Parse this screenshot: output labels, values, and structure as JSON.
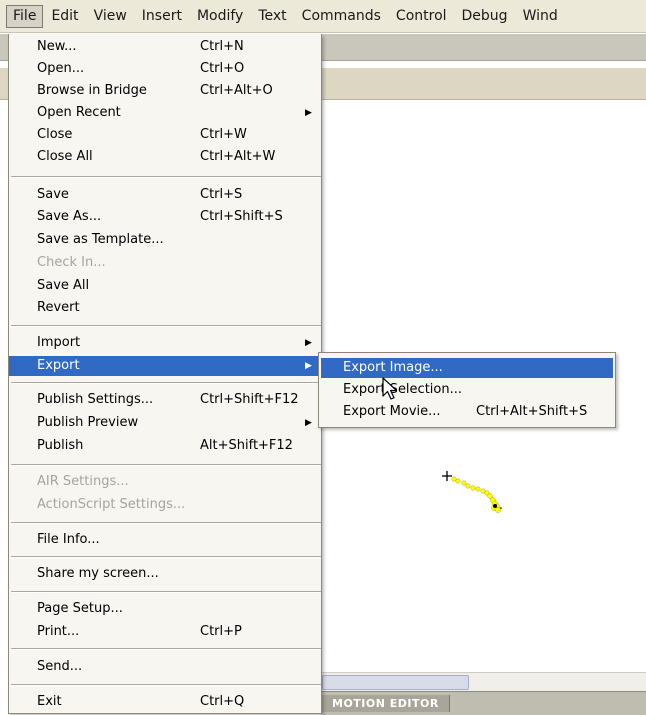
{
  "menubar": {
    "items": [
      "File",
      "Edit",
      "View",
      "Insert",
      "Modify",
      "Text",
      "Commands",
      "Control",
      "Debug",
      "Wind"
    ]
  },
  "file_menu": {
    "items": [
      {
        "label": "New...",
        "shortcut": "Ctrl+N"
      },
      {
        "label": "Open...",
        "shortcut": "Ctrl+O"
      },
      {
        "label": "Browse in Bridge",
        "shortcut": "Ctrl+Alt+O"
      },
      {
        "label": "Open Recent",
        "shortcut": ""
      },
      {
        "label": "Close",
        "shortcut": "Ctrl+W"
      },
      {
        "label": "Close All",
        "shortcut": "Ctrl+Alt+W"
      },
      {
        "label": "Save",
        "shortcut": "Ctrl+S"
      },
      {
        "label": "Save As...",
        "shortcut": "Ctrl+Shift+S"
      },
      {
        "label": "Save as Template...",
        "shortcut": ""
      },
      {
        "label": "Check In...",
        "shortcut": ""
      },
      {
        "label": "Save All",
        "shortcut": ""
      },
      {
        "label": "Revert",
        "shortcut": ""
      },
      {
        "label": "Import",
        "shortcut": ""
      },
      {
        "label": "Export",
        "shortcut": ""
      },
      {
        "label": "Publish Settings...",
        "shortcut": "Ctrl+Shift+F12"
      },
      {
        "label": "Publish Preview",
        "shortcut": ""
      },
      {
        "label": "Publish",
        "shortcut": "Alt+Shift+F12"
      },
      {
        "label": "AIR Settings...",
        "shortcut": ""
      },
      {
        "label": "ActionScript Settings...",
        "shortcut": ""
      },
      {
        "label": "File Info...",
        "shortcut": ""
      },
      {
        "label": "Share my screen...",
        "shortcut": ""
      },
      {
        "label": "Page Setup...",
        "shortcut": ""
      },
      {
        "label": "Print...",
        "shortcut": "Ctrl+P"
      },
      {
        "label": "Send...",
        "shortcut": ""
      },
      {
        "label": "Exit",
        "shortcut": "Ctrl+Q"
      }
    ]
  },
  "export_submenu": {
    "items": [
      {
        "label": "Export Image...",
        "shortcut": ""
      },
      {
        "label": "Export Selection...",
        "shortcut": ""
      },
      {
        "label": "Export Movie...",
        "shortcut": "Ctrl+Alt+Shift+S"
      }
    ]
  },
  "bottom_panel": {
    "tab_label": "MOTION EDITOR"
  },
  "colors": {
    "highlight": "#316ac5",
    "menu_bg": "#f7f6f1",
    "tween_dots": "#ffff00"
  },
  "icons": {
    "submenu_arrow": "submenu-arrow-icon",
    "cursor": "mouse-pointer-icon"
  }
}
